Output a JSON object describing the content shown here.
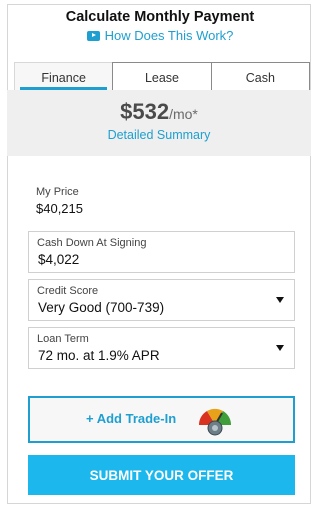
{
  "header": {
    "title": "Calculate Monthly Payment",
    "how_link": "How Does This Work?",
    "how_icon": "play-video-icon"
  },
  "tabs": [
    {
      "label": "Finance",
      "active": true
    },
    {
      "label": "Lease",
      "active": false
    },
    {
      "label": "Cash",
      "active": false
    }
  ],
  "summary": {
    "price": "$532",
    "unit": "/mo*",
    "detailed_link": "Detailed Summary"
  },
  "fields": {
    "my_price": {
      "label": "My Price",
      "value": "$40,215"
    },
    "cash_down": {
      "label": "Cash Down At Signing",
      "value": "$4,022"
    },
    "credit_score": {
      "label": "Credit Score",
      "value": "Very Good (700-739)"
    },
    "loan_term": {
      "label": "Loan Term",
      "value": "72 mo. at 1.9% APR"
    }
  },
  "trade_in": {
    "label": "+ Add Trade-In",
    "icon": "trade-in-gauge-icon"
  },
  "submit": {
    "label": "SUBMIT YOUR OFFER"
  },
  "colors": {
    "accent": "#1e9fd0",
    "submit_bg": "#1cb7ec",
    "summary_bg": "#efefef"
  }
}
